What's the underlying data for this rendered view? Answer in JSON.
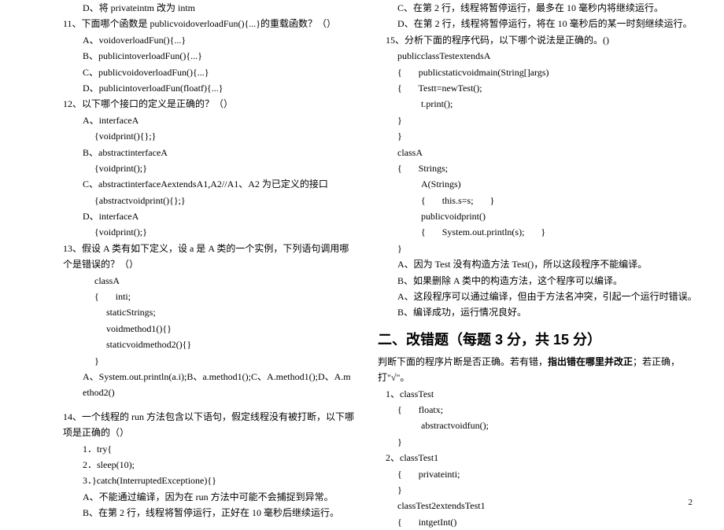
{
  "left": {
    "q10d": "D、将 privateintm 改为 intm",
    "q11": "11、下面哪个函数是 publicvoidoverloadFun(){...}的重载函数？（）",
    "q11a": "A、voidoverloadFun(){...}",
    "q11b": "B、publicintoverloadFun(){...}",
    "q11c": "C、publicvoidoverloadFun(){...}",
    "q11d": "D、publicintoverloadFun(floatf){...}",
    "q12": "12、以下哪个接口的定义是正确的？（）",
    "q12a": "A、interfaceA",
    "q12a_b": "{voidprint(){};}",
    "q12b": "B、abstractinterfaceA",
    "q12b_b": "{voidprint();}",
    "q12c": "C、abstractinterfaceAextendsA1,A2//A1、A2 为已定义的接口",
    "q12c_b": "{abstractvoidprint(){};}",
    "q12d": "D、interfaceA",
    "q12d_b": "{voidprint();}",
    "q13": "13、假设 A 类有如下定义，设 a 是 A 类的一个实例，下列语句调用哪个是错误的？（）",
    "q13_c1": "classA",
    "q13_c2": "{       inti;",
    "q13_c3": "staticStrings;",
    "q13_c4": "voidmethod1(){}",
    "q13_c5": "staticvoidmethod2(){}",
    "q13_c6": "}",
    "q13_ans": "A、System.out.println(a.i);B、a.method1();C、A.method1();D、A.method2()",
    "q14": "14、一个线程的 run 方法包含以下语句，假定线程没有被打断，以下哪项是正确的（）",
    "q14_1": "1．try{",
    "q14_2": "2．sleep(10);",
    "q14_3": "3．}catch(InterruptedExceptione){}",
    "q14a": "A、不能通过编译，因为在 run 方法中可能不会捕捉到异常。",
    "q14b": "B、在第 2 行，线程将暂停运行，正好在 10 毫秒后继续运行。"
  },
  "right": {
    "q14c": "C、在第 2 行，线程将暂停运行，最多在 10 毫秒内将继续运行。",
    "q14d": "D、在第 2 行，线程将暂停运行，将在 10 毫秒后的某一时刻继续运行。",
    "q15": "15、分析下面的程序代码，以下哪个说法是正确的。()",
    "q15_c1": "publicclassTestextendsA",
    "q15_c2": "{       publicstaticvoidmain(String[]args)",
    "q15_c3": "{       Testt=newTest();",
    "q15_c4": "t.print();",
    "q15_c5": "}",
    "q15_c6": "}",
    "q15_c7": "classA",
    "q15_c8": "{       Strings;",
    "q15_c9": "A(Strings)",
    "q15_c10": "{       this.s=s;       }",
    "q15_c11": "publicvoidprint()",
    "q15_c12": "{       System.out.println(s);       }",
    "q15_c13": "}",
    "q15a": "A、因为 Test 没有构造方法 Test()，所以这段程序不能编译。",
    "q15b": "B、如果删除 A 类中的构造方法，这个程序可以编译。",
    "q15c_o": "A、这段程序可以通过编译，但由于方法名冲突，引起一个运行时错误。",
    "q15d_o": "B、编译成功，运行情况良好。",
    "section2": "二、改错题（每题 3 分，共 15 分）",
    "section2_desc": "判断下面的程序片断是否正确。若有错，指出错在哪里并改正；若正确，打\"√\"。",
    "s2_1": "1、classTest",
    "s2_1_c1": "{       floatx;",
    "s2_1_c2": "abstractvoidfun();",
    "s2_1_c3": "}",
    "s2_2": "2、classTest1",
    "s2_2_c1": "{       privateinti;",
    "s2_2_c2": "}",
    "s2_2_c3": "classTest2extendsTest1",
    "s2_2_c4": "{       intgetInt()"
  },
  "sect2_desc_bold": "指出错在哪里并改正",
  "page_num": "2"
}
